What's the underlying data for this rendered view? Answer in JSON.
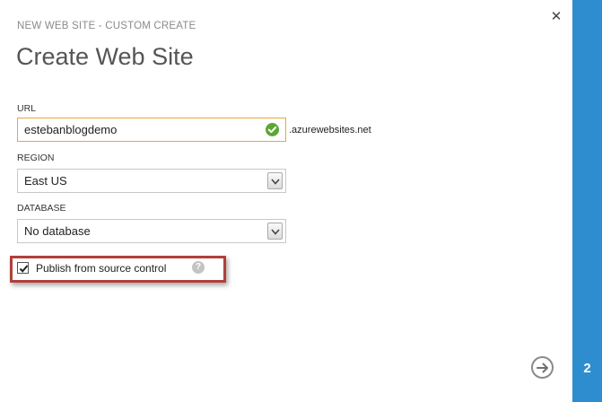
{
  "dialog": {
    "subtitle": "NEW WEB SITE - CUSTOM CREATE",
    "title": "Create Web Site",
    "close_icon": "close-icon",
    "close_glyph": "✕"
  },
  "form": {
    "url": {
      "label": "URL",
      "value": "estebanblogdemo",
      "suffix": ".azurewebsites.net",
      "status_icon": "check-circle-icon",
      "status_color": "#5aa832",
      "focus_color": "#e8a63a"
    },
    "region": {
      "label": "REGION",
      "value": "East US"
    },
    "database": {
      "label": "DATABASE",
      "value": "No database"
    },
    "publish": {
      "label": "Publish from source control",
      "checked": true,
      "help_glyph": "?",
      "highlight_color": "#b0403a"
    }
  },
  "navigation": {
    "next_icon": "arrow-right-icon",
    "step": "2",
    "sidebar_color": "#2e8dcf"
  }
}
